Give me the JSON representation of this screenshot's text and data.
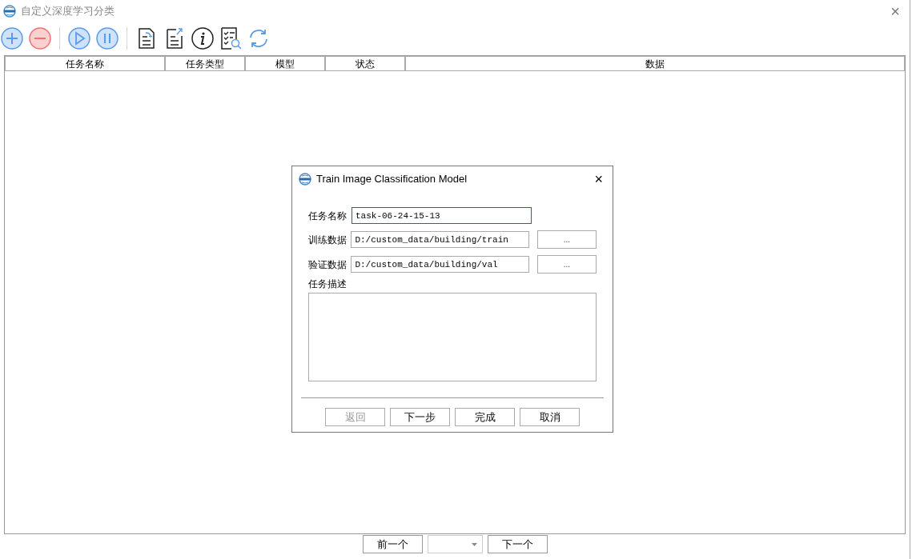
{
  "window": {
    "title": "自定义深度学习分类",
    "close": "×"
  },
  "toolbar": [
    {
      "kind": "add"
    },
    {
      "kind": "remove"
    },
    {
      "kind": "separator"
    },
    {
      "kind": "play"
    },
    {
      "kind": "pause"
    },
    {
      "kind": "separator"
    },
    {
      "kind": "import"
    },
    {
      "kind": "export"
    },
    {
      "kind": "info"
    },
    {
      "kind": "checklist"
    },
    {
      "kind": "refresh"
    }
  ],
  "table": {
    "columns": [
      "任务名称",
      "任务类型",
      "模型",
      "状态",
      "数据"
    ]
  },
  "dialog": {
    "title": "Train Image Classification Model",
    "fields": [
      {
        "label": "任务名称",
        "value": "task-06-24-15-13",
        "focused": true
      },
      {
        "label": "训练数据",
        "value": "D:/custom_data/building/train",
        "focused": false,
        "browse": "..."
      },
      {
        "label": "验证数据",
        "value": "D:/custom_data/building/val",
        "focused": false,
        "browse": "..."
      }
    ],
    "description_label": "任务描述",
    "buttons": [
      {
        "label": "返回",
        "disabled": true
      },
      {
        "label": "下一步",
        "disabled": false
      },
      {
        "label": "完成",
        "disabled": false
      },
      {
        "label": "取消",
        "disabled": false
      }
    ]
  },
  "pager": {
    "prev": "前一个",
    "next": "下一个"
  }
}
